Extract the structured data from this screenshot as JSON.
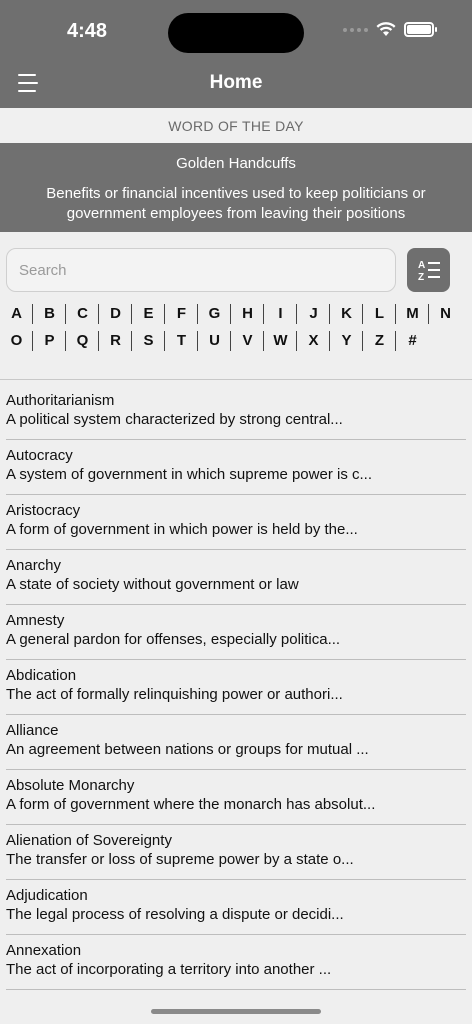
{
  "status_bar": {
    "time": "4:48"
  },
  "header": {
    "title": "Home"
  },
  "word_of_the_day": {
    "label": "WORD OF THE DAY",
    "word": "Golden Handcuffs",
    "definition": "Benefits or financial incentives used to keep politicians or government employees from leaving their positions"
  },
  "search": {
    "placeholder": "Search",
    "value": ""
  },
  "alphabet": {
    "row1": [
      "A",
      "B",
      "C",
      "D",
      "E",
      "F",
      "G",
      "H",
      "I",
      "J",
      "K",
      "L",
      "M",
      "N"
    ],
    "row2": [
      "O",
      "P",
      "Q",
      "R",
      "S",
      "T",
      "U",
      "V",
      "W",
      "X",
      "Y",
      "Z",
      "#"
    ]
  },
  "terms": [
    {
      "name": "Authoritarianism",
      "definition": "A political system characterized by strong central..."
    },
    {
      "name": "Autocracy",
      "definition": "A system of government in which supreme power is c..."
    },
    {
      "name": "Aristocracy",
      "definition": "A form of government in which power is held by the..."
    },
    {
      "name": "Anarchy",
      "definition": "A state of society without government or law"
    },
    {
      "name": "Amnesty",
      "definition": "A general pardon for offenses, especially politica..."
    },
    {
      "name": "Abdication",
      "definition": "The act of formally relinquishing power or authori..."
    },
    {
      "name": "Alliance",
      "definition": "An agreement between nations or groups for mutual ..."
    },
    {
      "name": "Absolute Monarchy",
      "definition": "A form of government where the monarch has absolut..."
    },
    {
      "name": "Alienation of Sovereignty",
      "definition": "The transfer or loss of supreme power by a state o..."
    },
    {
      "name": "Adjudication",
      "definition": "The legal process of resolving a dispute or decidi..."
    },
    {
      "name": "Annexation",
      "definition": "The act of incorporating a territory into another ..."
    }
  ],
  "icons": {
    "menu": "hamburger-menu-icon",
    "sort": "sort-alphabetical-icon",
    "wifi": "wifi-icon",
    "battery": "battery-icon"
  },
  "colors": {
    "header_bg": "#6f6f6f",
    "wotd_bg": "#707070",
    "page_bg": "#efefef"
  }
}
